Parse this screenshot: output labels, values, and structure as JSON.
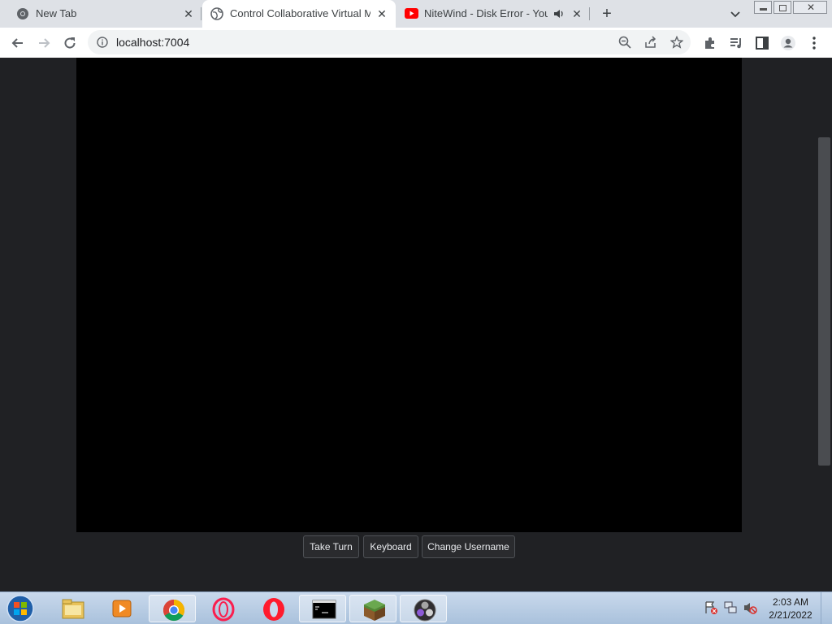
{
  "tabs": [
    {
      "title": "New Tab",
      "icon": "chrome-icon"
    },
    {
      "title": "Control Collaborative Virtual Ma",
      "icon": "globe-icon"
    },
    {
      "title": "NiteWind - Disk Error - YouTu",
      "icon": "youtube-icon"
    }
  ],
  "address": {
    "url": "localhost:7004"
  },
  "controls": {
    "take_turn": "Take Turn",
    "keyboard": "Keyboard",
    "change_username": "Change Username"
  },
  "taskbar": {
    "apps": [
      "explorer-icon",
      "media-player-icon",
      "chrome-icon",
      "opera-gx-icon",
      "opera-icon",
      "cmd-icon",
      "minecraft-icon",
      "obs-icon"
    ],
    "time": "2:03 AM",
    "date": "2/21/2022"
  },
  "colors": {
    "accent": "#1a73e8",
    "page_bg": "#202124",
    "youtube": "#ff0000"
  }
}
